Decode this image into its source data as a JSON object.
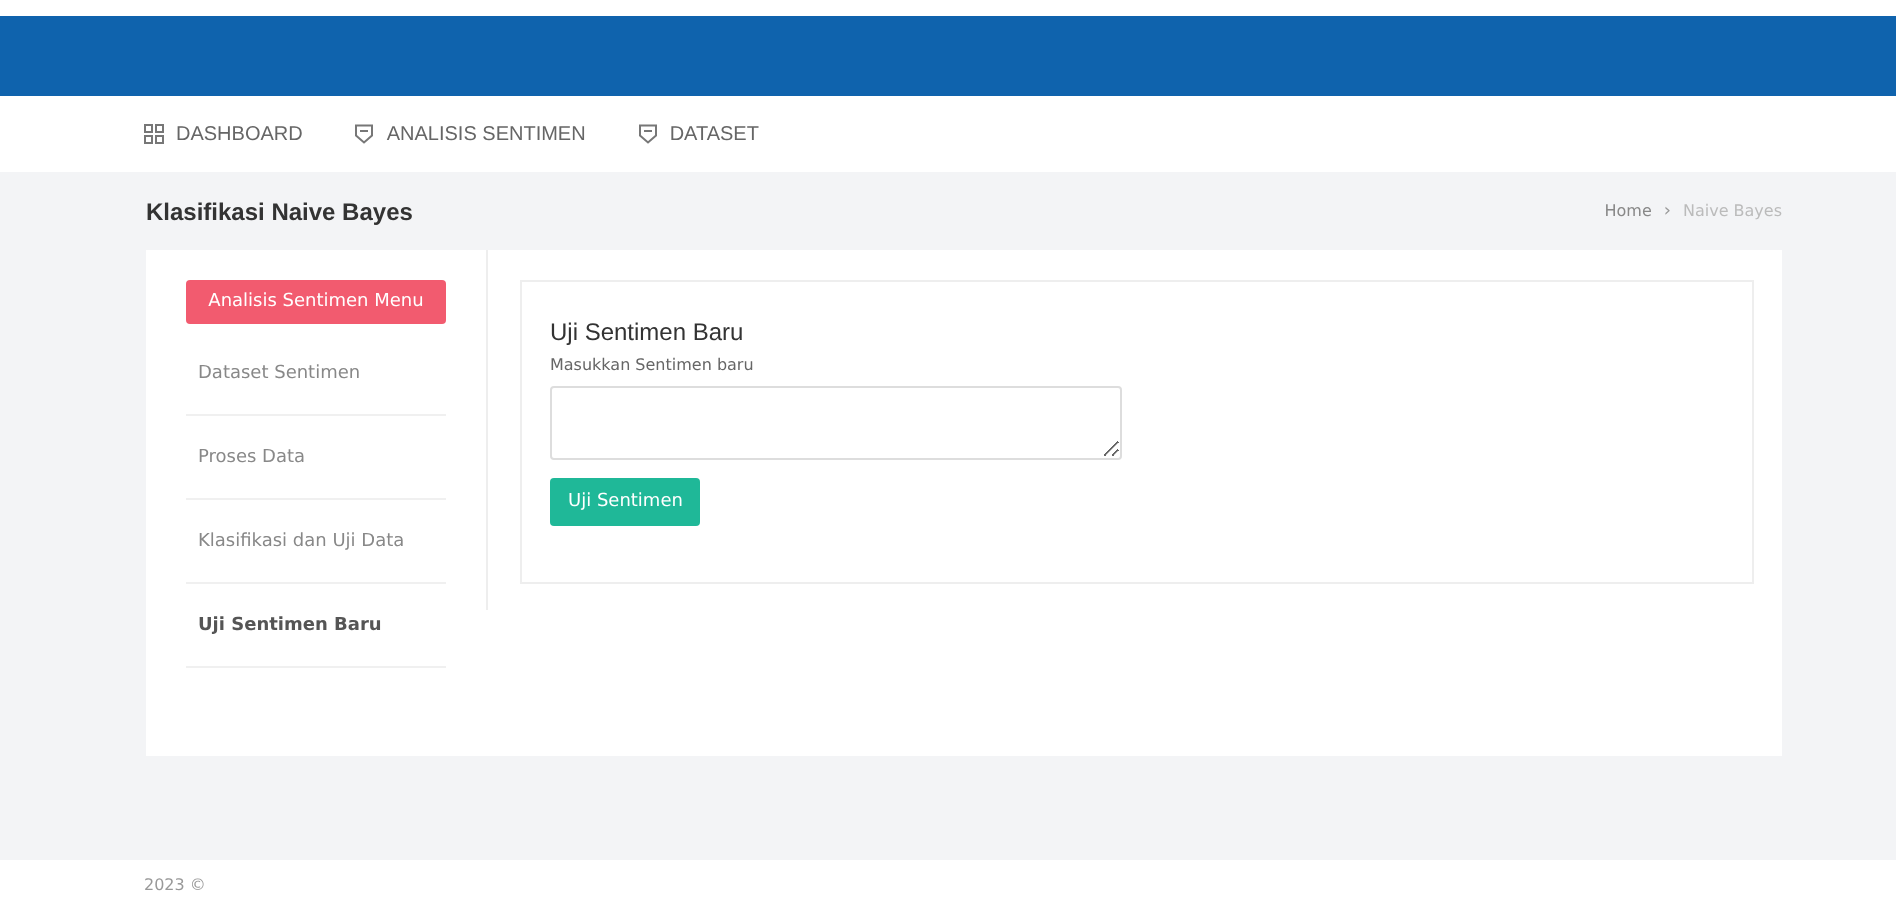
{
  "nav": {
    "items": [
      {
        "label": "DASHBOARD",
        "kind": "grid"
      },
      {
        "label": "ANALISIS SENTIMEN",
        "kind": "box"
      },
      {
        "label": "DATASET",
        "kind": "box"
      }
    ]
  },
  "page": {
    "title": "Klasifikasi Naive Bayes",
    "breadcrumb": [
      {
        "label": "Home",
        "selected": false
      },
      {
        "label": "Naive Bayes",
        "selected": true
      }
    ],
    "separator": "›"
  },
  "sidebar": {
    "menu_button": "Analisis Sentimen Menu",
    "items": [
      {
        "label": "Dataset Sentimen",
        "selected": false
      },
      {
        "label": "Proses Data",
        "selected": false
      },
      {
        "label": "Klasifikasi dan Uji Data",
        "selected": false
      },
      {
        "label": "Uji Sentimen Baru",
        "selected": true
      }
    ]
  },
  "form": {
    "title": "Uji Sentimen Baru",
    "label": "Masukkan Sentimen baru",
    "button": "Uji Sentimen"
  },
  "footer": {
    "text": "2023 ©"
  }
}
